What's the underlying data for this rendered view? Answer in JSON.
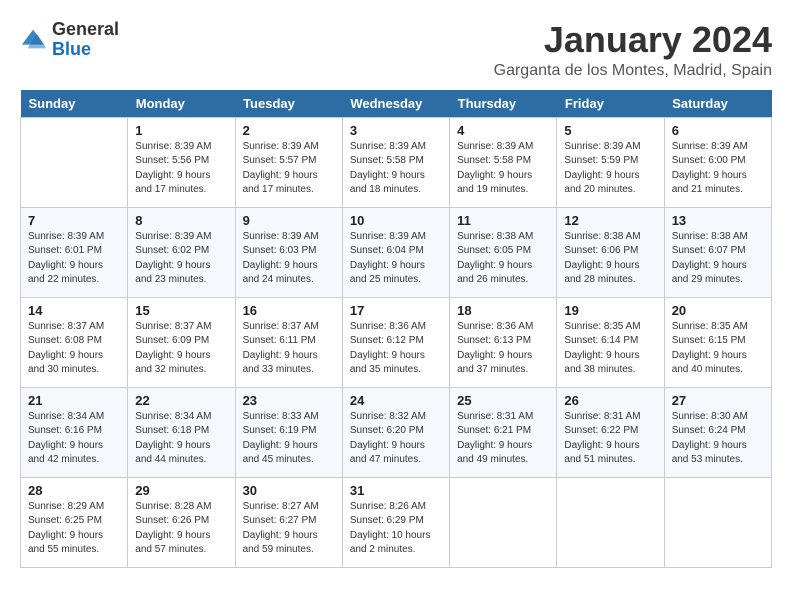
{
  "header": {
    "logo_general": "General",
    "logo_blue": "Blue",
    "month_title": "January 2024",
    "location": "Garganta de los Montes, Madrid, Spain"
  },
  "weekdays": [
    "Sunday",
    "Monday",
    "Tuesday",
    "Wednesday",
    "Thursday",
    "Friday",
    "Saturday"
  ],
  "weeks": [
    [
      {
        "day": "",
        "info": ""
      },
      {
        "day": "1",
        "info": "Sunrise: 8:39 AM\nSunset: 5:56 PM\nDaylight: 9 hours\nand 17 minutes."
      },
      {
        "day": "2",
        "info": "Sunrise: 8:39 AM\nSunset: 5:57 PM\nDaylight: 9 hours\nand 17 minutes."
      },
      {
        "day": "3",
        "info": "Sunrise: 8:39 AM\nSunset: 5:58 PM\nDaylight: 9 hours\nand 18 minutes."
      },
      {
        "day": "4",
        "info": "Sunrise: 8:39 AM\nSunset: 5:58 PM\nDaylight: 9 hours\nand 19 minutes."
      },
      {
        "day": "5",
        "info": "Sunrise: 8:39 AM\nSunset: 5:59 PM\nDaylight: 9 hours\nand 20 minutes."
      },
      {
        "day": "6",
        "info": "Sunrise: 8:39 AM\nSunset: 6:00 PM\nDaylight: 9 hours\nand 21 minutes."
      }
    ],
    [
      {
        "day": "7",
        "info": "Sunrise: 8:39 AM\nSunset: 6:01 PM\nDaylight: 9 hours\nand 22 minutes."
      },
      {
        "day": "8",
        "info": "Sunrise: 8:39 AM\nSunset: 6:02 PM\nDaylight: 9 hours\nand 23 minutes."
      },
      {
        "day": "9",
        "info": "Sunrise: 8:39 AM\nSunset: 6:03 PM\nDaylight: 9 hours\nand 24 minutes."
      },
      {
        "day": "10",
        "info": "Sunrise: 8:39 AM\nSunset: 6:04 PM\nDaylight: 9 hours\nand 25 minutes."
      },
      {
        "day": "11",
        "info": "Sunrise: 8:38 AM\nSunset: 6:05 PM\nDaylight: 9 hours\nand 26 minutes."
      },
      {
        "day": "12",
        "info": "Sunrise: 8:38 AM\nSunset: 6:06 PM\nDaylight: 9 hours\nand 28 minutes."
      },
      {
        "day": "13",
        "info": "Sunrise: 8:38 AM\nSunset: 6:07 PM\nDaylight: 9 hours\nand 29 minutes."
      }
    ],
    [
      {
        "day": "14",
        "info": "Sunrise: 8:37 AM\nSunset: 6:08 PM\nDaylight: 9 hours\nand 30 minutes."
      },
      {
        "day": "15",
        "info": "Sunrise: 8:37 AM\nSunset: 6:09 PM\nDaylight: 9 hours\nand 32 minutes."
      },
      {
        "day": "16",
        "info": "Sunrise: 8:37 AM\nSunset: 6:11 PM\nDaylight: 9 hours\nand 33 minutes."
      },
      {
        "day": "17",
        "info": "Sunrise: 8:36 AM\nSunset: 6:12 PM\nDaylight: 9 hours\nand 35 minutes."
      },
      {
        "day": "18",
        "info": "Sunrise: 8:36 AM\nSunset: 6:13 PM\nDaylight: 9 hours\nand 37 minutes."
      },
      {
        "day": "19",
        "info": "Sunrise: 8:35 AM\nSunset: 6:14 PM\nDaylight: 9 hours\nand 38 minutes."
      },
      {
        "day": "20",
        "info": "Sunrise: 8:35 AM\nSunset: 6:15 PM\nDaylight: 9 hours\nand 40 minutes."
      }
    ],
    [
      {
        "day": "21",
        "info": "Sunrise: 8:34 AM\nSunset: 6:16 PM\nDaylight: 9 hours\nand 42 minutes."
      },
      {
        "day": "22",
        "info": "Sunrise: 8:34 AM\nSunset: 6:18 PM\nDaylight: 9 hours\nand 44 minutes."
      },
      {
        "day": "23",
        "info": "Sunrise: 8:33 AM\nSunset: 6:19 PM\nDaylight: 9 hours\nand 45 minutes."
      },
      {
        "day": "24",
        "info": "Sunrise: 8:32 AM\nSunset: 6:20 PM\nDaylight: 9 hours\nand 47 minutes."
      },
      {
        "day": "25",
        "info": "Sunrise: 8:31 AM\nSunset: 6:21 PM\nDaylight: 9 hours\nand 49 minutes."
      },
      {
        "day": "26",
        "info": "Sunrise: 8:31 AM\nSunset: 6:22 PM\nDaylight: 9 hours\nand 51 minutes."
      },
      {
        "day": "27",
        "info": "Sunrise: 8:30 AM\nSunset: 6:24 PM\nDaylight: 9 hours\nand 53 minutes."
      }
    ],
    [
      {
        "day": "28",
        "info": "Sunrise: 8:29 AM\nSunset: 6:25 PM\nDaylight: 9 hours\nand 55 minutes."
      },
      {
        "day": "29",
        "info": "Sunrise: 8:28 AM\nSunset: 6:26 PM\nDaylight: 9 hours\nand 57 minutes."
      },
      {
        "day": "30",
        "info": "Sunrise: 8:27 AM\nSunset: 6:27 PM\nDaylight: 9 hours\nand 59 minutes."
      },
      {
        "day": "31",
        "info": "Sunrise: 8:26 AM\nSunset: 6:29 PM\nDaylight: 10 hours\nand 2 minutes."
      },
      {
        "day": "",
        "info": ""
      },
      {
        "day": "",
        "info": ""
      },
      {
        "day": "",
        "info": ""
      }
    ]
  ]
}
